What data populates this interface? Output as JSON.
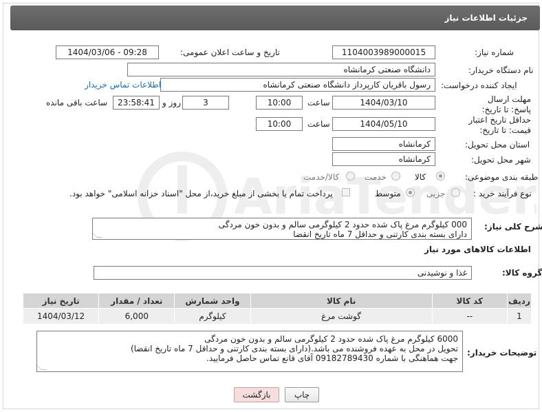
{
  "title": "جزئیات اطلاعات نیاز",
  "watermark_text": "AriaTender.net",
  "fields": {
    "need_number_label": "شماره نیاز:",
    "need_number": "1104003989000015",
    "announce_label": "تاریخ و ساعت اعلان عمومی:",
    "announce_value": "1404/03/06 - 09:28",
    "buyer_org_label": "نام دستگاه خریدار:",
    "buyer_org": "دانشگاه صنعتی کرمانشاه",
    "creator_label": "ایجاد کننده درخواست:",
    "creator": "رسول باقریان کارپرداز دانشگاه صنعتی کرمانشاه",
    "contact_link": "اطلاعات تماس خریدار",
    "deadline_label": "مهلت ارسال پاسخ: تا تاریخ:",
    "deadline_date": "1404/03/10",
    "time_label": "ساعت",
    "deadline_time": "10:00",
    "days_value": "3",
    "days_label": "روز و",
    "remaining_time": "23:58:41",
    "remaining_label": "ساعت باقی مانده",
    "min_validity_label": "حداقل تاریخ اعتبار قیمت: تا تاریخ:",
    "validity_date": "1404/05/10",
    "validity_time": "10:00",
    "province_label": "استان محل تحویل:",
    "province": "کرمانشاه",
    "city_label": "شهر محل تحویل:",
    "city": "کرمانشاه",
    "category_label": "طبقه بندی موضوعی:",
    "category_options": [
      "کالا",
      "خدمت",
      "کالا/خدمت"
    ],
    "process_label": "نوع فرآیند خرید :",
    "process_options": [
      "جزیی",
      "متوسط"
    ],
    "payment_note": "پرداخت تمام یا بخشی از مبلغ خرید،از محل \"اسناد خزانه اسلامی\" خواهد بود.",
    "description_label": "شرح کلی نیاز:",
    "description_lines": [
      "000 کیلوگرم مرغ پاک شده حدود 2 کیلوگرمی سالم و بدون خون مردگی",
      "دارای بسته بندی کارتنی و حداقل 7 ماه تاریخ انقضا"
    ],
    "goods_info_heading": "اطلاعات کالاهای مورد نیاز",
    "goods_group_label": "گروه کالا:",
    "goods_group": "غذا و نوشیدنی",
    "buyer_notes_label": "توضیحات خریدار:",
    "buyer_notes_lines": [
      "6000 کیلوگرم مرغ پاک شده حدود 2 کیلوگرمی سالم و بدون خون مردگی",
      "تحویل در محل به عهده فروشنده می باشد.(دارای بسته بندی کارتنی و حداقل 7 ماه تاریخ انقضا)",
      "جهت هماهنگی با شماره 09182789430 آقای قانع تماس حاصل فرمایید."
    ]
  },
  "table": {
    "headers": [
      "ردیف",
      "کد کالا",
      "نام کالا",
      "واحد شمارش",
      "تعداد / مقدار",
      "تاریخ نیاز"
    ],
    "rows": [
      [
        "1",
        "--",
        "گوشت مرغ",
        "کیلوگرم",
        "6,000",
        "1404/03/12"
      ]
    ]
  },
  "buttons": {
    "print": "چاپ",
    "back": "بازگشت"
  },
  "colors": {
    "title_bar": "#646464",
    "link": "#1a6fb5",
    "table_header": "#d5d5d5",
    "table_row": "#eeeeee",
    "back_button_bg": "#f6dede"
  }
}
